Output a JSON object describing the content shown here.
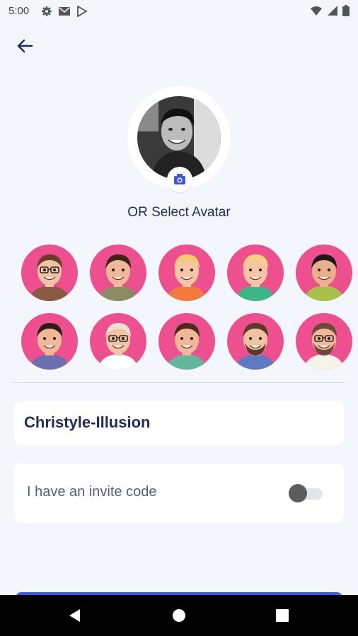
{
  "status_bar": {
    "time": "5:00",
    "left_icons": [
      "gear-icon",
      "gmail-icon",
      "play-store-icon"
    ],
    "right_icons": [
      "wifi-icon",
      "signal-icon",
      "battery-icon"
    ]
  },
  "header": {
    "back_icon": "arrow-left-icon"
  },
  "profile": {
    "photo_icon": "profile-photo",
    "camera_icon": "camera-icon"
  },
  "avatar_section": {
    "label": "OR Select Avatar",
    "avatars": [
      {
        "hair": "#6b3d2a",
        "skin": "#f2c3a0",
        "shirt": "#8a5a45",
        "glasses": true,
        "beard": false
      },
      {
        "hair": "#3b2418",
        "skin": "#f0b89a",
        "shirt": "#8c8c64",
        "glasses": false,
        "beard": false
      },
      {
        "hair": "#f0cc6a",
        "skin": "#f6c6a4",
        "shirt": "#f47b3b",
        "glasses": false,
        "beard": false
      },
      {
        "hair": "#f2d37a",
        "skin": "#f6c6a4",
        "shirt": "#3fb58a",
        "glasses": false,
        "beard": false
      },
      {
        "hair": "#1f1a18",
        "skin": "#e8b08c",
        "shirt": "#a6c24a",
        "glasses": false,
        "beard": false
      },
      {
        "hair": "#2a1e18",
        "skin": "#f0b896",
        "shirt": "#6b6fb0",
        "glasses": false,
        "beard": false
      },
      {
        "hair": "#e9e2d8",
        "skin": "#f2c3a0",
        "shirt": "#ffffff",
        "glasses": true,
        "beard": false
      },
      {
        "hair": "#4a2c1e",
        "skin": "#f0b896",
        "shirt": "#63b79a",
        "glasses": false,
        "beard": false
      },
      {
        "hair": "#5a3a28",
        "skin": "#f2c3a0",
        "shirt": "#5f79c2",
        "glasses": false,
        "beard": true
      },
      {
        "hair": "#6a4a38",
        "skin": "#f0b896",
        "shirt": "#f6f4e8",
        "glasses": true,
        "beard": true
      }
    ]
  },
  "username": {
    "value": "Christyle-Illusion"
  },
  "invite": {
    "label": "I have an invite code",
    "enabled": false
  },
  "colors": {
    "accent": "#3e58e0",
    "avatar_bg": "#ee4f8f",
    "text_dark": "#1f2d5a"
  },
  "nav_bar": {
    "icons": [
      "back-triangle-icon",
      "home-circle-icon",
      "recents-square-icon"
    ]
  }
}
